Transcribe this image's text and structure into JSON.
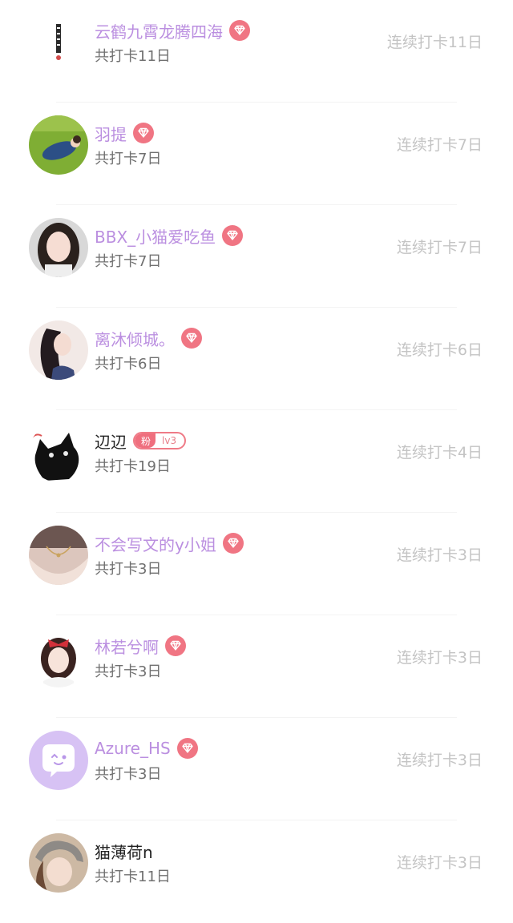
{
  "entries": [
    {
      "name": "云鹤九霄龙腾四海",
      "total": "共打卡11日",
      "streak": "连续打卡11日",
      "badge": "vip",
      "avatar": "calligraphy"
    },
    {
      "name": "羽提",
      "total": "共打卡7日",
      "streak": "连续打卡7日",
      "badge": "vip",
      "avatar": "grass-photo"
    },
    {
      "name": "BBX_小猫爱吃鱼",
      "total": "共打卡7日",
      "streak": "连续打卡7日",
      "badge": "vip",
      "avatar": "girl-photo"
    },
    {
      "name": "离沐倾城。",
      "total": "共打卡6日",
      "streak": "连续打卡6日",
      "badge": "vip",
      "avatar": "long-hair-art"
    },
    {
      "name": "辺辺",
      "total": "共打卡19日",
      "streak": "连续打卡4日",
      "badge": "fan",
      "fan_tag": "粉",
      "fan_level": "lv3",
      "avatar": "black-cat"
    },
    {
      "name": "不会写文的y小姐",
      "total": "共打卡3日",
      "streak": "连续打卡3日",
      "badge": "vip",
      "avatar": "necklace-photo"
    },
    {
      "name": "林若兮啊",
      "total": "共打卡3日",
      "streak": "连续打卡3日",
      "badge": "vip",
      "avatar": "red-bow-art"
    },
    {
      "name": "Azure_HS",
      "total": "共打卡3日",
      "streak": "连续打卡3日",
      "badge": "vip",
      "avatar": "default-chat-bubble"
    },
    {
      "name": "猫薄荷n",
      "total": "共打卡11日",
      "streak": "连续打卡3日",
      "badge": "none",
      "avatar": "hat-photo"
    }
  ],
  "colors": {
    "vip_name": "#bb8fe0",
    "plain_name": "#222222",
    "vip_badge": "#f07583",
    "streak_text": "#c4c4c4",
    "total_text": "#707070"
  },
  "icons": {
    "vip": "diamond-icon"
  }
}
